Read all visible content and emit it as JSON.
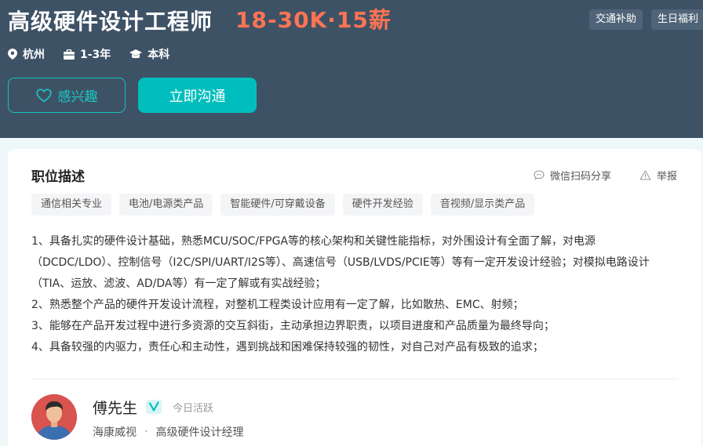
{
  "job": {
    "title": "高级硬件设计工程师",
    "salary": "18-30K·15薪",
    "perks": [
      "交通补助",
      "生日福利"
    ],
    "location": "杭州",
    "experience": "1-3年",
    "education": "本科"
  },
  "actions": {
    "interest_label": "感兴趣",
    "chat_label": "立即沟通"
  },
  "description": {
    "section_title": "职位描述",
    "share_label": "微信扫码分享",
    "report_label": "举报",
    "tags": [
      "通信相关专业",
      "电池/电源类产品",
      "智能硬件/可穿戴设备",
      "硬件开发经验",
      "音视频/显示类产品"
    ],
    "lines": [
      "1、具备扎实的硬件设计基础，熟悉MCU/SOC/FPGA等的核心架构和关键性能指标，对外围设计有全面了解，对电源（DCDC/LDO）、控制信号（I2C/SPI/UART/I2S等）、高速信号（USB/LVDS/PCIE等）等有一定开发设计经验；对模拟电路设计（TIA、运放、滤波、AD/DA等）有一定了解或有实战经验；",
      "2、熟悉整个产品的硬件开发设计流程，对整机工程类设计应用有一定了解，比如散热、EMC、射频；",
      "3、能够在产品开发过程中进行多资源的交互斜街，主动承担边界职责，以项目进度和产品质量为最终导向；",
      "4、具备较强的内驱力，责任心和主动性，遇到挑战和困难保持较强的韧性，对自己对产品有极致的追求；"
    ]
  },
  "recruiter": {
    "name": "傅先生",
    "status": "今日活跃",
    "company": "海康威视",
    "position": "高级硬件设计经理"
  },
  "colors": {
    "header_bg": "#3e5266",
    "salary": "#ff7452",
    "accent": "#00bebd"
  }
}
